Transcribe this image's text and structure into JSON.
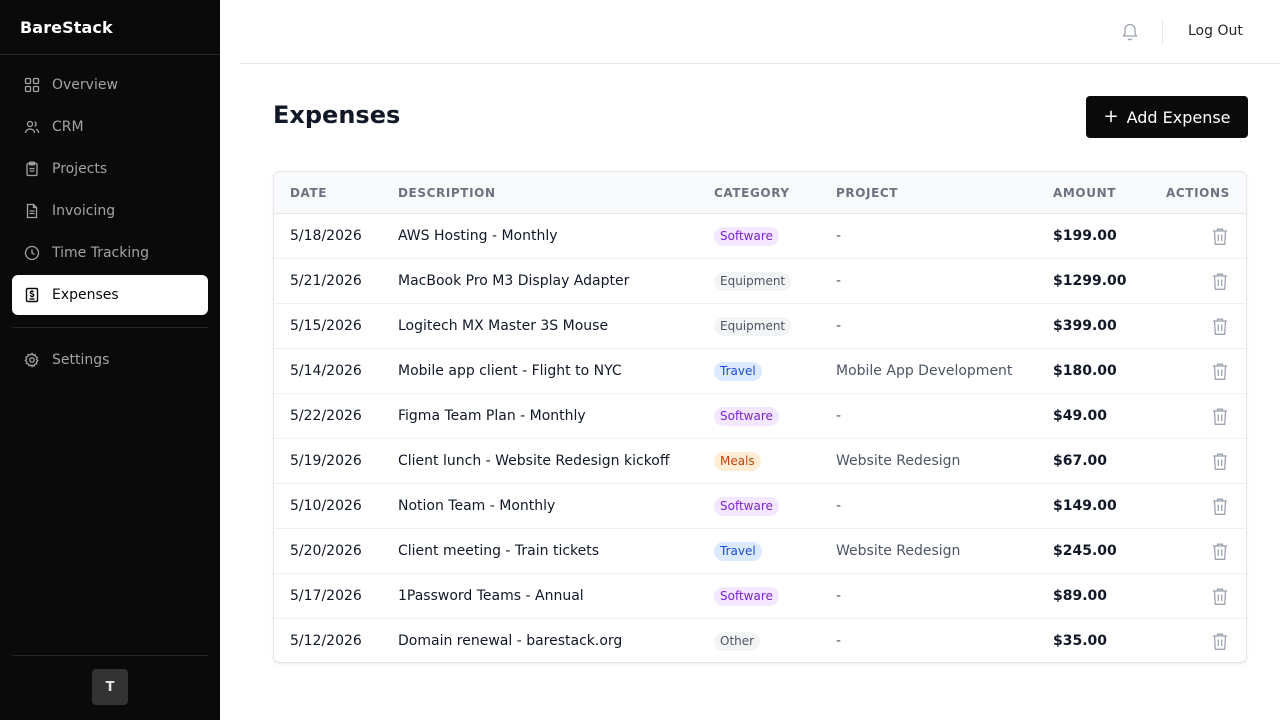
{
  "app": {
    "name": "BareStack"
  },
  "sidebar": {
    "items": [
      {
        "label": "Overview",
        "icon": "grid-icon"
      },
      {
        "label": "CRM",
        "icon": "users-icon"
      },
      {
        "label": "Projects",
        "icon": "clipboard-icon"
      },
      {
        "label": "Invoicing",
        "icon": "file-text-icon"
      },
      {
        "label": "Time Tracking",
        "icon": "clock-icon"
      },
      {
        "label": "Expenses",
        "icon": "receipt-icon",
        "active": true
      }
    ],
    "settings": {
      "label": "Settings",
      "icon": "gear-icon"
    },
    "avatar_initial": "T"
  },
  "header": {
    "logout_label": "Log Out"
  },
  "page": {
    "title": "Expenses",
    "add_button_label": "Add Expense"
  },
  "table": {
    "columns": [
      "DATE",
      "DESCRIPTION",
      "CATEGORY",
      "PROJECT",
      "AMOUNT",
      "ACTIONS"
    ],
    "rows": [
      {
        "date": "5/18/2026",
        "description": "AWS Hosting - Monthly",
        "category": "Software",
        "project": "-",
        "amount": "$199.00"
      },
      {
        "date": "5/21/2026",
        "description": "MacBook Pro M3 Display Adapter",
        "category": "Equipment",
        "project": "-",
        "amount": "$1299.00"
      },
      {
        "date": "5/15/2026",
        "description": "Logitech MX Master 3S Mouse",
        "category": "Equipment",
        "project": "-",
        "amount": "$399.00"
      },
      {
        "date": "5/14/2026",
        "description": "Mobile app client - Flight to NYC",
        "category": "Travel",
        "project": "Mobile App Development",
        "amount": "$180.00"
      },
      {
        "date": "5/22/2026",
        "description": "Figma Team Plan - Monthly",
        "category": "Software",
        "project": "-",
        "amount": "$49.00"
      },
      {
        "date": "5/19/2026",
        "description": "Client lunch - Website Redesign kickoff",
        "category": "Meals",
        "project": "Website Redesign",
        "amount": "$67.00"
      },
      {
        "date": "5/10/2026",
        "description": "Notion Team - Monthly",
        "category": "Software",
        "project": "-",
        "amount": "$149.00"
      },
      {
        "date": "5/20/2026",
        "description": "Client meeting - Train tickets",
        "category": "Travel",
        "project": "Website Redesign",
        "amount": "$245.00"
      },
      {
        "date": "5/17/2026",
        "description": "1Password Teams - Annual",
        "category": "Software",
        "project": "-",
        "amount": "$89.00"
      },
      {
        "date": "5/12/2026",
        "description": "Domain renewal - barestack.org",
        "category": "Other",
        "project": "-",
        "amount": "$35.00"
      }
    ]
  },
  "colors": {
    "sidebar_bg": "#0a0a0a",
    "accent": "#0a0a0a",
    "software": "#7e22ce",
    "equipment": "#4b5563",
    "travel": "#1d4ed8",
    "meals": "#c2410c",
    "other": "#4b5563"
  }
}
